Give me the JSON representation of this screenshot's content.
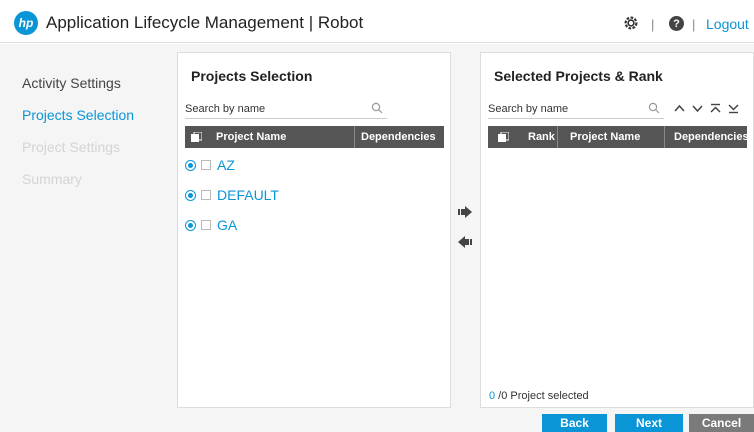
{
  "header": {
    "logo_text": "hp",
    "title": "Application Lifecycle Management | Robot",
    "separator": "|",
    "help_glyph": "?",
    "logout_label": "Logout"
  },
  "nav": {
    "items": [
      {
        "label": "Activity Settings",
        "state": "normal"
      },
      {
        "label": "Projects Selection",
        "state": "active"
      },
      {
        "label": "Project Settings",
        "state": "disabled"
      },
      {
        "label": "Summary",
        "state": "disabled"
      }
    ]
  },
  "projects_panel": {
    "title": "Projects Selection",
    "search_placeholder": "Search by name",
    "columns": [
      "Project Name",
      "Dependencies"
    ],
    "rows": [
      "AZ",
      "DEFAULT",
      "GA"
    ]
  },
  "selected_panel": {
    "title": "Selected Projects & Rank",
    "search_placeholder": "Search by name",
    "columns": [
      "Rank",
      "Project Name",
      "Dependencies"
    ],
    "selected_count": "0",
    "count_suffix": " /0 Project selected"
  },
  "buttons": {
    "back": "Back",
    "next": "Next",
    "cancel": "Cancel"
  },
  "icons": {
    "settings": "gear-icon",
    "help": "help-icon",
    "search": "search-icon",
    "add": "move-right-arrow-icon",
    "remove": "move-left-arrow-icon",
    "rank_up": "chevron-up-icon",
    "rank_down": "chevron-down-icon",
    "rank_top": "move-to-top-icon",
    "rank_bottom": "move-to-bottom-icon"
  },
  "colors": {
    "accent": "#0a96d6",
    "table_header": "#555555",
    "button_grey": "#7a7a7a",
    "disabled_text": "#d4d4d4"
  }
}
